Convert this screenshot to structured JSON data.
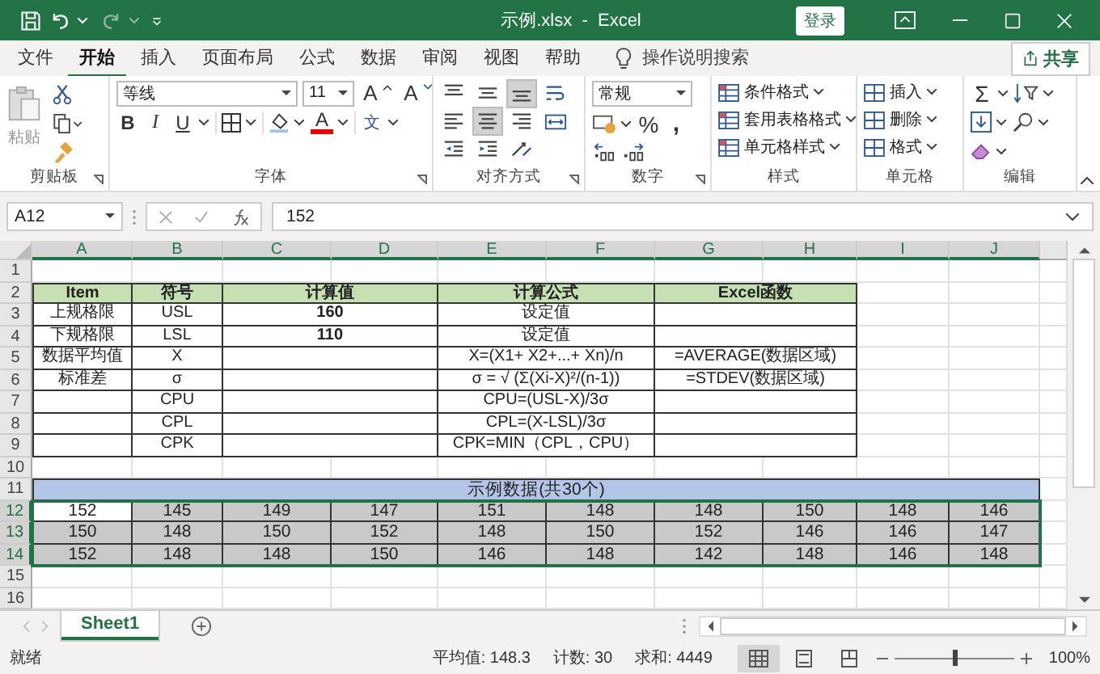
{
  "title_bar": {
    "title": "示例.xlsx  -  Excel",
    "login_button": "登录"
  },
  "ribbon_tabs": [
    {
      "label": "文件",
      "selected": false
    },
    {
      "label": "开始",
      "selected": true
    },
    {
      "label": "插入",
      "selected": false
    },
    {
      "label": "页面布局",
      "selected": false
    },
    {
      "label": "公式",
      "selected": false
    },
    {
      "label": "数据",
      "selected": false
    },
    {
      "label": "审阅",
      "selected": false
    },
    {
      "label": "视图",
      "selected": false
    },
    {
      "label": "帮助",
      "selected": false
    }
  ],
  "tell_me": {
    "placeholder": "操作说明搜索"
  },
  "share_button": "共享",
  "ribbon": {
    "clipboard": {
      "paste": "粘贴",
      "label": "剪贴板"
    },
    "font": {
      "font_name": "等线",
      "font_size": "11",
      "grow": "A",
      "shrink": "A",
      "bold": "B",
      "italic": "I",
      "underline": "U",
      "font_color": "A",
      "phonetic": "文",
      "label": "字体"
    },
    "alignment": {
      "label": "对齐方式",
      "buttons": [
        {
          "kind": "top",
          "selected": false
        },
        {
          "kind": "middle",
          "selected": false
        },
        {
          "kind": "bottom",
          "selected": true
        },
        {
          "kind": "wrap",
          "selected": false
        },
        {
          "kind": "left",
          "selected": false
        },
        {
          "kind": "center",
          "selected": true
        },
        {
          "kind": "right",
          "selected": false
        },
        {
          "kind": "merge",
          "selected": false
        },
        {
          "kind": "outdent",
          "selected": false
        },
        {
          "kind": "indent",
          "selected": false
        },
        {
          "kind": "orientation",
          "selected": false
        }
      ]
    },
    "number": {
      "format": "常规",
      "percent": "%",
      "comma": ",",
      "label": "数字"
    },
    "styles": {
      "items": [
        "条件格式",
        "套用表格格式",
        "单元格样式"
      ],
      "label": "样式"
    },
    "cells": {
      "items": [
        "插入",
        "删除",
        "格式"
      ],
      "label": "单元格"
    },
    "editing": {
      "sum": "Σ",
      "label": "编辑"
    }
  },
  "formula_bar": {
    "name_box": "A12",
    "value": "152"
  },
  "columns": [
    {
      "label": "A",
      "selected": true
    },
    {
      "label": "B",
      "selected": true
    },
    {
      "label": "C",
      "selected": true
    },
    {
      "label": "D",
      "selected": true
    },
    {
      "label": "E",
      "selected": true
    },
    {
      "label": "F",
      "selected": true
    },
    {
      "label": "G",
      "selected": true
    },
    {
      "label": "H",
      "selected": true
    },
    {
      "label": "I",
      "selected": true
    },
    {
      "label": "J",
      "selected": true
    }
  ],
  "row_headers": [
    {
      "label": "1",
      "selected": false
    },
    {
      "label": "2",
      "selected": false
    },
    {
      "label": "3",
      "selected": false
    },
    {
      "label": "4",
      "selected": false
    },
    {
      "label": "5",
      "selected": false
    },
    {
      "label": "6",
      "selected": false
    },
    {
      "label": "7",
      "selected": false
    },
    {
      "label": "8",
      "selected": false
    },
    {
      "label": "9",
      "selected": false
    },
    {
      "label": "10",
      "selected": false
    },
    {
      "label": "11",
      "selected": false
    },
    {
      "label": "12",
      "selected": true
    },
    {
      "label": "13",
      "selected": true
    },
    {
      "label": "14",
      "selected": true
    },
    {
      "label": "15",
      "selected": false
    },
    {
      "label": "16",
      "selected": false
    }
  ],
  "table": {
    "header": [
      "Item",
      "符号",
      "计算值",
      "计算公式",
      "Excel函数"
    ],
    "rows": [
      {
        "item": "上规格限",
        "symbol": "USL",
        "value": "160",
        "formula": "设定值"
      },
      {
        "item": "下规格限",
        "symbol": "LSL",
        "value": "110",
        "formula": "设定值"
      },
      {
        "item": "数据平均值",
        "symbol": "X",
        "formula": "X=(X1+ X2+...+ Xn)/n",
        "function": "=AVERAGE(数据区域)"
      },
      {
        "item": "标准差",
        "symbol": "σ",
        "formula": "σ = √ (Σ(Xi-X)²/(n-1))",
        "function": "=STDEV(数据区域)"
      },
      {
        "symbol": "CPU",
        "formula": "CPU=(USL-X)/3σ"
      },
      {
        "symbol": "CPL",
        "formula": "CPL=(X-LSL)/3σ"
      },
      {
        "symbol": "CPK",
        "formula": "CPK=MIN（CPL，CPU）"
      }
    ]
  },
  "sample_data": {
    "title": "示例数据(共30个)",
    "rows": [
      [
        {
          "value": "152",
          "active": true
        },
        {
          "value": "145",
          "active": false
        },
        {
          "value": "149",
          "active": false
        },
        {
          "value": "147",
          "active": false
        },
        {
          "value": "151",
          "active": false
        },
        {
          "value": "148",
          "active": false
        },
        {
          "value": "148",
          "active": false
        },
        {
          "value": "150",
          "active": false
        },
        {
          "value": "148",
          "active": false
        },
        {
          "value": "146",
          "active": false
        }
      ],
      [
        {
          "value": "150",
          "active": false
        },
        {
          "value": "148",
          "active": false
        },
        {
          "value": "150",
          "active": false
        },
        {
          "value": "152",
          "active": false
        },
        {
          "value": "148",
          "active": false
        },
        {
          "value": "150",
          "active": false
        },
        {
          "value": "152",
          "active": false
        },
        {
          "value": "146",
          "active": false
        },
        {
          "value": "146",
          "active": false
        },
        {
          "value": "147",
          "active": false
        }
      ],
      [
        {
          "value": "152",
          "active": false
        },
        {
          "value": "148",
          "active": false
        },
        {
          "value": "148",
          "active": false
        },
        {
          "value": "150",
          "active": false
        },
        {
          "value": "146",
          "active": false
        },
        {
          "value": "148",
          "active": false
        },
        {
          "value": "142",
          "active": false
        },
        {
          "value": "148",
          "active": false
        },
        {
          "value": "146",
          "active": false
        },
        {
          "value": "148",
          "active": false
        }
      ]
    ]
  },
  "sheet_tabs": [
    {
      "label": "Sheet1",
      "selected": true
    }
  ],
  "status_bar": {
    "ready": "就绪",
    "average": "平均值: 148.3",
    "count": "计数: 30",
    "sum": "求和: 4449",
    "views": [
      {
        "kind": "normal",
        "selected": true
      },
      {
        "kind": "page_layout",
        "selected": false
      },
      {
        "kind": "page_break",
        "selected": false
      }
    ],
    "zoom": {
      "level": 0.5,
      "reading": "100%"
    }
  }
}
